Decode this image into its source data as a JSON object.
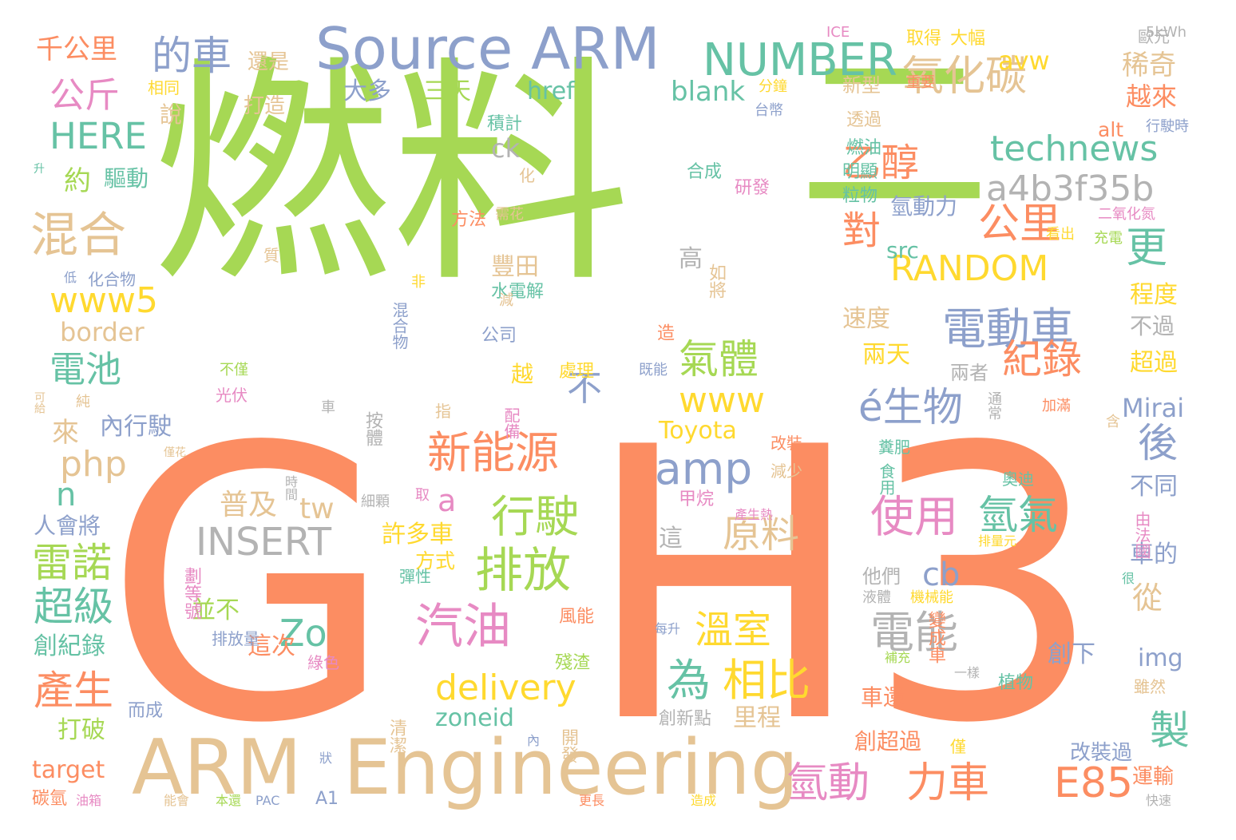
{
  "palette": {
    "green": "#a6d854",
    "orange": "#fc8d62",
    "blue": "#8da0cb",
    "tan": "#e5c494",
    "teal": "#66c2a5",
    "pink": "#e78ac3",
    "yellow": "#ffd92f",
    "gray": "#b3b3b3"
  },
  "words": [
    {
      "text": "燃料",
      "color": "green"
    },
    {
      "text": "G",
      "color": "orange"
    },
    {
      "text": "H3",
      "color": "orange"
    },
    {
      "text": "二",
      "color": "green"
    },
    {
      "text": "ARM",
      "color": "tan"
    },
    {
      "text": "Engineering",
      "color": "tan"
    },
    {
      "text": "Source ARM",
      "color": "blue"
    },
    {
      "text": "NUMBER",
      "color": "teal"
    },
    {
      "text": "氧化碳",
      "color": "tan"
    },
    {
      "text": "電動車",
      "color": "blue"
    },
    {
      "text": "technews",
      "color": "teal"
    },
    {
      "text": "a4b3f35b",
      "color": "gray"
    },
    {
      "text": "RANDOM",
      "color": "yellow"
    },
    {
      "text": "公里",
      "color": "orange"
    },
    {
      "text": "更",
      "color": "teal"
    },
    {
      "text": "乙醇",
      "color": "orange"
    },
    {
      "text": "混合",
      "color": "tan"
    },
    {
      "text": "的車",
      "color": "blue"
    },
    {
      "text": "公斤",
      "color": "pink"
    },
    {
      "text": "HERE",
      "color": "teal"
    },
    {
      "text": "電池",
      "color": "teal"
    },
    {
      "text": "www5",
      "color": "yellow"
    },
    {
      "text": "php",
      "color": "tan"
    },
    {
      "text": "雷諾",
      "color": "green"
    },
    {
      "text": "超級",
      "color": "teal"
    },
    {
      "text": "產生",
      "color": "orange"
    },
    {
      "text": "新能源",
      "color": "orange"
    },
    {
      "text": "行駛",
      "color": "green"
    },
    {
      "text": "排放",
      "color": "green"
    },
    {
      "text": "汽油",
      "color": "pink"
    },
    {
      "text": "amp",
      "color": "blue"
    },
    {
      "text": "www",
      "color": "yellow"
    },
    {
      "text": "氣體",
      "color": "green"
    },
    {
      "text": "紀錄",
      "color": "orange"
    },
    {
      "text": "使用",
      "color": "pink"
    },
    {
      "text": "氫氣",
      "color": "teal"
    },
    {
      "text": "後",
      "color": "blue"
    },
    {
      "text": "製",
      "color": "teal"
    },
    {
      "text": "電能",
      "color": "gray"
    },
    {
      "text": "為",
      "color": "teal"
    },
    {
      "text": "相比",
      "color": "yellow"
    },
    {
      "text": "氫動",
      "color": "pink"
    },
    {
      "text": "力車",
      "color": "orange"
    },
    {
      "text": "E85",
      "color": "orange"
    },
    {
      "text": "INSERT",
      "color": "gray"
    },
    {
      "text": "delivery",
      "color": "yellow"
    },
    {
      "text": "原料",
      "color": "tan"
    },
    {
      "text": "溫室",
      "color": "yellow"
    },
    {
      "text": "é生物",
      "color": "blue"
    },
    {
      "text": "cb",
      "color": "blue"
    },
    {
      "text": "Zo",
      "color": "teal"
    },
    {
      "text": "稀奇",
      "color": "tan"
    },
    {
      "text": "avw",
      "color": "yellow"
    },
    {
      "text": "千公里",
      "color": "orange"
    },
    {
      "text": "還是",
      "color": "tan"
    },
    {
      "text": "大多",
      "color": "blue"
    },
    {
      "text": "三天",
      "color": "green"
    },
    {
      "text": "href",
      "color": "teal"
    },
    {
      "text": "blank",
      "color": "teal"
    },
    {
      "text": "越來",
      "color": "orange"
    },
    {
      "text": "alt",
      "color": "orange"
    },
    {
      "text": "約",
      "color": "green"
    },
    {
      "text": "驅動",
      "color": "teal"
    },
    {
      "text": "說",
      "color": "tan"
    },
    {
      "text": "打造",
      "color": "tan"
    },
    {
      "text": "ck",
      "color": "gray"
    },
    {
      "text": "積計",
      "color": "teal"
    },
    {
      "text": "新型",
      "color": "tan"
    },
    {
      "text": "透過",
      "color": "tan"
    },
    {
      "text": "燃油",
      "color": "teal"
    },
    {
      "text": "明顯",
      "color": "teal"
    },
    {
      "text": "粒物",
      "color": "teal"
    },
    {
      "text": "合成",
      "color": "teal"
    },
    {
      "text": "研發",
      "color": "pink"
    },
    {
      "text": "氫動力",
      "color": "blue"
    },
    {
      "text": "對",
      "color": "orange"
    },
    {
      "text": "src",
      "color": "teal"
    },
    {
      "text": "豐田",
      "color": "tan"
    },
    {
      "text": "高",
      "color": "gray"
    },
    {
      "text": "速度",
      "color": "tan"
    },
    {
      "text": "兩天",
      "color": "yellow"
    },
    {
      "text": "兩者",
      "color": "gray"
    },
    {
      "text": "不過",
      "color": "gray"
    },
    {
      "text": "程度",
      "color": "yellow"
    },
    {
      "text": "超過",
      "color": "yellow"
    },
    {
      "text": "不",
      "color": "blue"
    },
    {
      "text": "Mirai",
      "color": "blue"
    },
    {
      "text": "Toyota",
      "color": "yellow"
    },
    {
      "text": "border",
      "color": "tan"
    },
    {
      "text": "內行駛",
      "color": "blue"
    },
    {
      "text": "來",
      "color": "tan"
    },
    {
      "text": "n",
      "color": "teal"
    },
    {
      "text": "a",
      "color": "pink"
    },
    {
      "text": "普及",
      "color": "tan"
    },
    {
      "text": "tw",
      "color": "tan"
    },
    {
      "text": "許多車",
      "color": "yellow"
    },
    {
      "text": "方式",
      "color": "yellow"
    },
    {
      "text": "人會將",
      "color": "blue"
    },
    {
      "text": "並不",
      "color": "green"
    },
    {
      "text": "這次",
      "color": "orange"
    },
    {
      "text": "創紀錄",
      "color": "teal"
    },
    {
      "text": "打破",
      "color": "green"
    },
    {
      "text": "target",
      "color": "orange"
    },
    {
      "text": "zoneid",
      "color": "teal"
    },
    {
      "text": "里程",
      "color": "tan"
    },
    {
      "text": "不同",
      "color": "blue"
    },
    {
      "text": "車的",
      "color": "blue"
    },
    {
      "text": "從",
      "color": "tan"
    },
    {
      "text": "創下",
      "color": "blue"
    },
    {
      "text": "img",
      "color": "blue"
    },
    {
      "text": "這",
      "color": "gray"
    },
    {
      "text": "他們",
      "color": "gray"
    },
    {
      "text": "車還",
      "color": "orange"
    },
    {
      "text": "創超過",
      "color": "orange"
    },
    {
      "text": "改裝過",
      "color": "blue"
    },
    {
      "text": "運輸",
      "color": "orange"
    },
    {
      "text": "ICE",
      "color": "pink"
    },
    {
      "text": "取得",
      "color": "yellow"
    },
    {
      "text": "大幅",
      "color": "yellow"
    },
    {
      "text": "歐元",
      "color": "gray"
    },
    {
      "text": "5kWh",
      "color": "gray"
    },
    {
      "text": "重要",
      "color": "orange"
    },
    {
      "text": "行駛時",
      "color": "blue"
    },
    {
      "text": "二氧化氮",
      "color": "pink"
    },
    {
      "text": "充電",
      "color": "green"
    },
    {
      "text": "分鐘",
      "color": "yellow"
    },
    {
      "text": "台幣",
      "color": "blue"
    },
    {
      "text": "相同",
      "color": "yellow"
    },
    {
      "text": "升",
      "color": "teal"
    },
    {
      "text": "化",
      "color": "tan"
    },
    {
      "text": "需花",
      "color": "tan"
    },
    {
      "text": "方法",
      "color": "orange"
    },
    {
      "text": "看出",
      "color": "yellow"
    },
    {
      "text": "低",
      "color": "blue"
    },
    {
      "text": "化合物",
      "color": "blue"
    },
    {
      "text": "質",
      "color": "tan"
    },
    {
      "text": "如將",
      "color": "tan"
    },
    {
      "text": "水電解",
      "color": "teal"
    },
    {
      "text": "非",
      "color": "yellow"
    },
    {
      "text": "混合物",
      "color": "blue"
    },
    {
      "text": "減",
      "color": "tan"
    },
    {
      "text": "公司",
      "color": "blue"
    },
    {
      "text": "造",
      "color": "orange"
    },
    {
      "text": "越",
      "color": "yellow"
    },
    {
      "text": "處理",
      "color": "yellow"
    },
    {
      "text": "既能",
      "color": "blue"
    },
    {
      "text": "不僅",
      "color": "green"
    },
    {
      "text": "光伏",
      "color": "pink"
    },
    {
      "text": "可給",
      "color": "tan"
    },
    {
      "text": "純",
      "color": "tan"
    },
    {
      "text": "車",
      "color": "gray"
    },
    {
      "text": "按體",
      "color": "gray"
    },
    {
      "text": "指",
      "color": "tan"
    },
    {
      "text": "配備",
      "color": "pink"
    },
    {
      "text": "通常",
      "color": "gray"
    },
    {
      "text": "加滿",
      "color": "orange"
    },
    {
      "text": "含",
      "color": "tan"
    },
    {
      "text": "改裝",
      "color": "orange"
    },
    {
      "text": "減少",
      "color": "tan"
    },
    {
      "text": "糞肥",
      "color": "teal"
    },
    {
      "text": "食用",
      "color": "teal"
    },
    {
      "text": "奧迪",
      "color": "teal"
    },
    {
      "text": "僅花",
      "color": "tan"
    },
    {
      "text": "時間",
      "color": "gray"
    },
    {
      "text": "細顆",
      "color": "gray"
    },
    {
      "text": "取",
      "color": "pink"
    },
    {
      "text": "甲烷",
      "color": "pink"
    },
    {
      "text": "產生熱",
      "color": "pink"
    },
    {
      "text": "由法國",
      "color": "pink"
    },
    {
      "text": "排量元",
      "color": "yellow"
    },
    {
      "text": "劃等號",
      "color": "pink"
    },
    {
      "text": "彈性",
      "color": "teal"
    },
    {
      "text": "很",
      "color": "teal"
    },
    {
      "text": "液體",
      "color": "gray"
    },
    {
      "text": "機械能",
      "color": "yellow"
    },
    {
      "text": "風能",
      "color": "orange"
    },
    {
      "text": "排放量",
      "color": "blue"
    },
    {
      "text": "綠色",
      "color": "pink"
    },
    {
      "text": "殘渣",
      "color": "green"
    },
    {
      "text": "每升",
      "color": "blue"
    },
    {
      "text": "變成車",
      "color": "orange"
    },
    {
      "text": "一樣",
      "color": "gray"
    },
    {
      "text": "補充",
      "color": "green"
    },
    {
      "text": "植物",
      "color": "teal"
    },
    {
      "text": "雖然",
      "color": "tan"
    },
    {
      "text": "而成",
      "color": "blue"
    },
    {
      "text": "創新點",
      "color": "gray"
    },
    {
      "text": "清潔",
      "color": "tan"
    },
    {
      "text": "內",
      "color": "blue"
    },
    {
      "text": "開發",
      "color": "tan"
    },
    {
      "text": "僅",
      "color": "yellow"
    },
    {
      "text": "狀",
      "color": "blue"
    },
    {
      "text": "碳氫",
      "color": "orange"
    },
    {
      "text": "油箱",
      "color": "pink"
    },
    {
      "text": "能會",
      "color": "tan"
    },
    {
      "text": "本還",
      "color": "green"
    },
    {
      "text": "PAC",
      "color": "blue"
    },
    {
      "text": "A1",
      "color": "blue"
    },
    {
      "text": "更長",
      "color": "orange"
    },
    {
      "text": "造成",
      "color": "yellow"
    },
    {
      "text": "快速",
      "color": "gray"
    }
  ]
}
